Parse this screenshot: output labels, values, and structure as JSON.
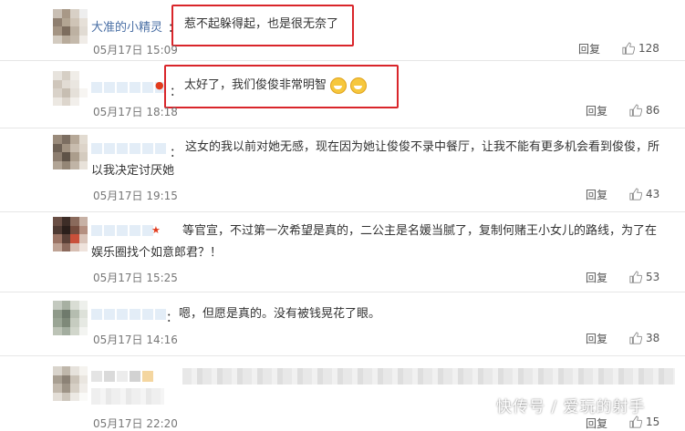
{
  "comments": [
    {
      "username": "大准的小精灵",
      "text": "惹不起躲得起，也是很无奈了",
      "time": "05月17日 15:09",
      "reply": "回复",
      "likes": "128"
    },
    {
      "username": "",
      "text": "太好了，我们俊俊非常明智",
      "time": "05月17日 18:18",
      "reply": "回复",
      "likes": "86"
    },
    {
      "username": "",
      "text_line1": "这女的我以前对她无感，现在因为她让俊俊不录中餐厅，让我不能有更多机会看到俊俊，所",
      "text_line2": "以我决定讨厌她",
      "time": "05月17日 19:15",
      "reply": "回复",
      "likes": "43"
    },
    {
      "username": "",
      "text_line1": "等官宣，不过第一次希望是真的，二公主是名媛当腻了，复制何赌王小女儿的路线，为了在",
      "text_line2": "娱乐圈找个如意郎君？！",
      "time": "05月17日 15:25",
      "reply": "回复",
      "likes": "53"
    },
    {
      "username": "",
      "text": "嗯，但愿是真的。没有被钱晃花了眼。",
      "time": "05月17日 14:16",
      "reply": "回复",
      "likes": "38"
    },
    {
      "username": "",
      "time": "05月17日 22:20",
      "reply": "回复",
      "likes": "15"
    }
  ],
  "colon": "：",
  "watermark": "快传号 / 爱玩的射手",
  "colors": {
    "highlight_box": "#d9252a",
    "username": "#4a6fa5",
    "text": "#333333",
    "meta": "#777777"
  },
  "icons": {
    "like": "thumbs-up-icon",
    "emoji": "grinning-face-icon"
  }
}
